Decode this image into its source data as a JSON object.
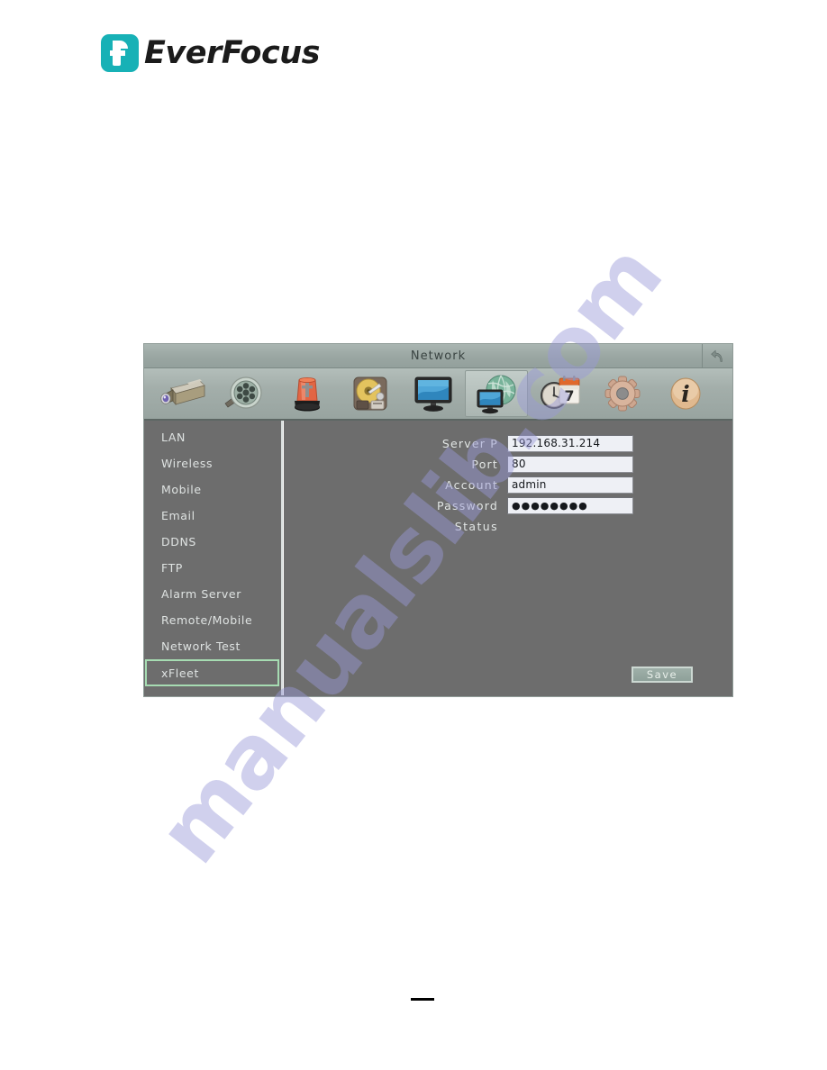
{
  "brand": {
    "name": "EverFocus",
    "mark_color": "#17b1b6",
    "text_color": "#1b1b1b"
  },
  "watermark": {
    "text": "manualslib.com",
    "color": "#9a9ad8"
  },
  "window": {
    "title": "Network",
    "back_icon": "back-arrow-icon",
    "title_bar_color": "#9aa6a2",
    "body_color": "#6d6d6d"
  },
  "toolbar": {
    "icons": [
      {
        "name": "camera-icon",
        "label": "Camera",
        "selected": false
      },
      {
        "name": "film-reel-icon",
        "label": "Record",
        "selected": false
      },
      {
        "name": "alarm-siren-icon",
        "label": "Alarm",
        "selected": false
      },
      {
        "name": "hard-disk-icon",
        "label": "Disk",
        "selected": false
      },
      {
        "name": "monitor-icon",
        "label": "Display",
        "selected": false
      },
      {
        "name": "network-globe-icon",
        "label": "Network",
        "selected": true
      },
      {
        "name": "clock-calendar-icon",
        "label": "Date/Time",
        "selected": false
      },
      {
        "name": "gear-icon",
        "label": "System",
        "selected": false
      },
      {
        "name": "info-icon",
        "label": "Information",
        "selected": false
      }
    ]
  },
  "sidebar": {
    "items": [
      {
        "label": "LAN",
        "selected": false
      },
      {
        "label": "Wireless",
        "selected": false
      },
      {
        "label": "Mobile",
        "selected": false
      },
      {
        "label": "Email",
        "selected": false
      },
      {
        "label": "DDNS",
        "selected": false
      },
      {
        "label": "FTP",
        "selected": false
      },
      {
        "label": "Alarm Server",
        "selected": false
      },
      {
        "label": "Remote/Mobile",
        "selected": false
      },
      {
        "label": "Network Test",
        "selected": false
      },
      {
        "label": "xFleet",
        "selected": true
      }
    ],
    "selected_border_color": "#a6dcb2"
  },
  "form": {
    "fields": [
      {
        "label": "Server  P",
        "value": "192.168.31.214",
        "type": "text"
      },
      {
        "label": "Port",
        "value": "80",
        "type": "text"
      },
      {
        "label": "Account",
        "value": "admin",
        "type": "text"
      },
      {
        "label": "Password",
        "value": "●●●●●●●●",
        "type": "password"
      },
      {
        "label": "Status",
        "value": "",
        "type": "readonly"
      }
    ],
    "save_label": "Save"
  }
}
